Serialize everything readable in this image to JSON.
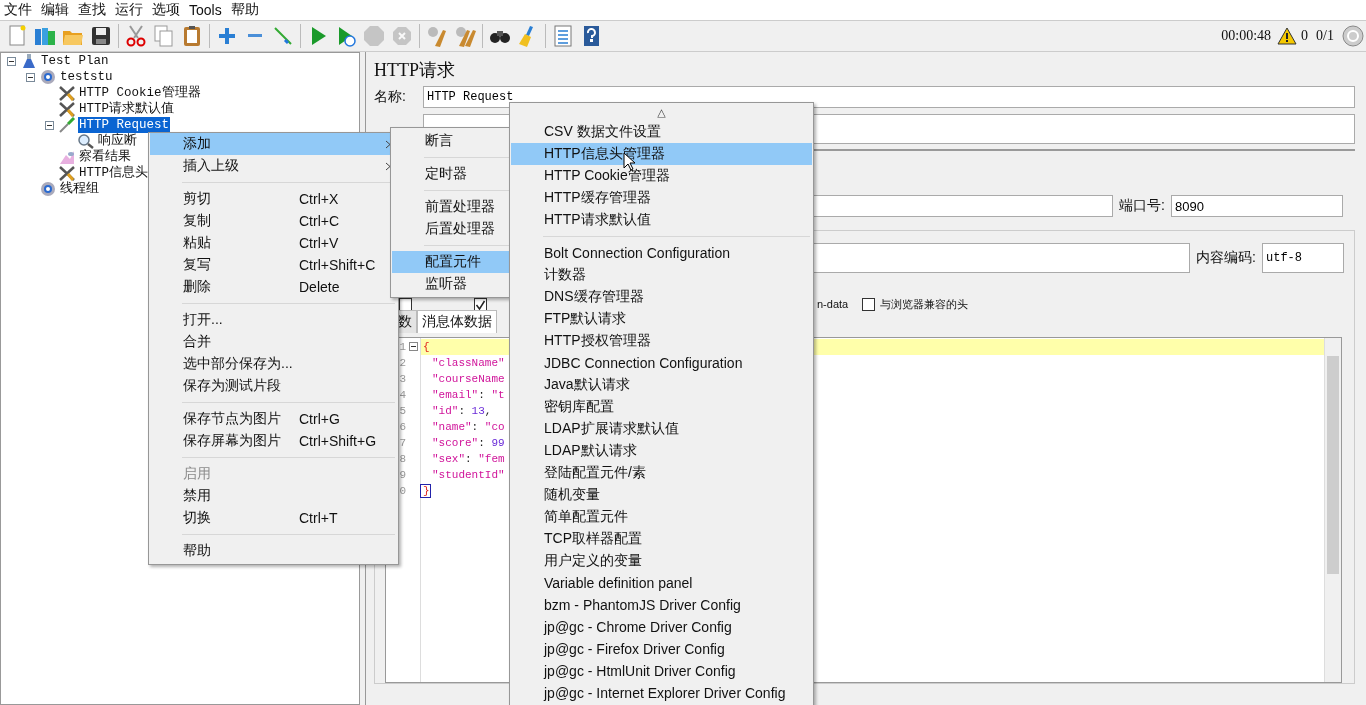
{
  "menubar": [
    "文件",
    "编辑",
    "查找",
    "运行",
    "选项",
    "Tools",
    "帮助"
  ],
  "toolbar": [
    {
      "kind": "new",
      "disabled": false
    },
    {
      "kind": "templates",
      "disabled": false
    },
    {
      "kind": "open",
      "disabled": false
    },
    {
      "kind": "save",
      "disabled": false
    },
    {
      "kind": "separator"
    },
    {
      "kind": "cut",
      "disabled": false
    },
    {
      "kind": "copy",
      "disabled": false
    },
    {
      "kind": "paste",
      "disabled": false
    },
    {
      "kind": "separator"
    },
    {
      "kind": "expand",
      "disabled": false
    },
    {
      "kind": "collapse",
      "disabled": false
    },
    {
      "kind": "toggle",
      "disabled": false
    },
    {
      "kind": "separator"
    },
    {
      "kind": "start",
      "disabled": false
    },
    {
      "kind": "start-no-pause",
      "disabled": false
    },
    {
      "kind": "stop",
      "disabled": true
    },
    {
      "kind": "shutdown",
      "disabled": true
    },
    {
      "kind": "separator"
    },
    {
      "kind": "clear",
      "disabled": false
    },
    {
      "kind": "clear-all",
      "disabled": false
    },
    {
      "kind": "separator"
    },
    {
      "kind": "search",
      "disabled": false
    },
    {
      "kind": "reset",
      "disabled": false
    },
    {
      "kind": "separator"
    },
    {
      "kind": "function-helper",
      "disabled": false
    },
    {
      "kind": "help",
      "disabled": false
    }
  ],
  "status": {
    "elapsed": "00:00:48",
    "warnings": "0",
    "threads": "0/1"
  },
  "tree": [
    {
      "label": "Test Plan",
      "kind": "plan",
      "selected": false,
      "expanded": true,
      "children": [
        {
          "label": "teststu",
          "kind": "group",
          "selected": false,
          "expanded": true,
          "children": [
            {
              "label": "HTTP Cookie管理器",
              "kind": "config",
              "selected": false
            },
            {
              "label": "HTTP请求默认值",
              "kind": "config",
              "selected": false
            },
            {
              "label": "HTTP Request",
              "kind": "sampler",
              "selected": true,
              "expanded": true,
              "children": [
                {
                  "label": "响应断",
                  "kind": "assertion",
                  "selected": false
                }
              ]
            },
            {
              "label": "察看结果",
              "kind": "listener",
              "selected": false
            },
            {
              "label": "HTTP信息头",
              "kind": "config",
              "selected": false
            }
          ]
        },
        {
          "label": "线程组",
          "kind": "group",
          "selected": false
        }
      ]
    }
  ],
  "panel": {
    "title": "HTTP请求",
    "name_label": "名称:",
    "name_value": "HTTP Request",
    "port_label": "端口号:",
    "port_value": "8090",
    "encoding_label": "内容编码:",
    "encoding_value": "utf-8",
    "checkboxes": [
      {
        "checked": false
      },
      {
        "checked": true
      },
      {
        "label": "n-data"
      },
      {
        "label": "与浏览器兼容的头",
        "checked": false
      }
    ],
    "tabs": [
      {
        "label": "数",
        "selected": false
      },
      {
        "label": "消息体数据",
        "selected": true
      }
    ],
    "editor": {
      "line_numbers": [
        "1",
        "2",
        "3",
        "4",
        "5",
        "6",
        "7",
        "8",
        "9",
        "0"
      ],
      "lines": [
        [
          {
            "kind": "brace",
            "text": "{"
          }
        ],
        [
          {
            "kind": "string",
            "text": "\"className\""
          }
        ],
        [
          {
            "kind": "string",
            "text": "\"courseName"
          }
        ],
        [
          {
            "kind": "string",
            "text": "\"email\""
          },
          {
            "kind": "plain",
            "text": ": "
          },
          {
            "kind": "string",
            "text": "\"t"
          }
        ],
        [
          {
            "kind": "string",
            "text": "\"id\""
          },
          {
            "kind": "plain",
            "text": ": "
          },
          {
            "kind": "number",
            "text": "13"
          },
          {
            "kind": "plain",
            "text": ","
          }
        ],
        [
          {
            "kind": "string",
            "text": "\"name\""
          },
          {
            "kind": "plain",
            "text": ": "
          },
          {
            "kind": "string",
            "text": "\"co"
          }
        ],
        [
          {
            "kind": "string",
            "text": "\"score\""
          },
          {
            "kind": "plain",
            "text": ": "
          },
          {
            "kind": "number",
            "text": "99"
          }
        ],
        [
          {
            "kind": "string",
            "text": "\"sex\""
          },
          {
            "kind": "plain",
            "text": ": "
          },
          {
            "kind": "string",
            "text": "\"fem"
          }
        ],
        [
          {
            "kind": "string",
            "text": "\"studentId\""
          }
        ],
        [
          {
            "kind": "brace",
            "text": "}"
          }
        ]
      ]
    }
  },
  "context_menu": [
    {
      "label": "添加",
      "kind": "submenu",
      "selected": true,
      "disabled": false
    },
    {
      "label": "插入上级",
      "kind": "submenu",
      "selected": false,
      "disabled": false
    },
    {
      "kind": "separator"
    },
    {
      "label": "剪切",
      "shortcut": "Ctrl+X",
      "kind": "item",
      "selected": false,
      "disabled": false
    },
    {
      "label": "复制",
      "shortcut": "Ctrl+C",
      "kind": "item",
      "selected": false,
      "disabled": false
    },
    {
      "label": "粘贴",
      "shortcut": "Ctrl+V",
      "kind": "item",
      "selected": false,
      "disabled": false
    },
    {
      "label": "复写",
      "shortcut": "Ctrl+Shift+C",
      "kind": "item",
      "selected": false,
      "disabled": false
    },
    {
      "label": "删除",
      "shortcut": "Delete",
      "kind": "item",
      "selected": false,
      "disabled": false
    },
    {
      "kind": "separator"
    },
    {
      "label": "打开...",
      "kind": "item",
      "selected": false,
      "disabled": false
    },
    {
      "label": "合并",
      "kind": "item",
      "selected": false,
      "disabled": false
    },
    {
      "label": "选中部分保存为...",
      "kind": "item",
      "selected": false,
      "disabled": false
    },
    {
      "label": "保存为测试片段",
      "kind": "item",
      "selected": false,
      "disabled": false
    },
    {
      "kind": "separator"
    },
    {
      "label": "保存节点为图片",
      "shortcut": "Ctrl+G",
      "kind": "item",
      "selected": false,
      "disabled": false
    },
    {
      "label": "保存屏幕为图片",
      "shortcut": "Ctrl+Shift+G",
      "kind": "item",
      "selected": false,
      "disabled": false
    },
    {
      "kind": "separator"
    },
    {
      "label": "启用",
      "kind": "item",
      "selected": false,
      "disabled": true
    },
    {
      "label": "禁用",
      "kind": "item",
      "selected": false,
      "disabled": false
    },
    {
      "label": "切换",
      "shortcut": "Ctrl+T",
      "kind": "item",
      "selected": false,
      "disabled": false
    },
    {
      "kind": "separator"
    },
    {
      "label": "帮助",
      "kind": "item",
      "selected": false,
      "disabled": false
    }
  ],
  "add_submenu": [
    {
      "label": "断言",
      "kind": "submenu",
      "selected": false
    },
    {
      "kind": "separator"
    },
    {
      "label": "定时器",
      "kind": "submenu",
      "selected": false
    },
    {
      "kind": "separator"
    },
    {
      "label": "前置处理器",
      "kind": "submenu",
      "selected": false
    },
    {
      "label": "后置处理器",
      "kind": "submenu",
      "selected": false
    },
    {
      "kind": "separator"
    },
    {
      "label": "配置元件",
      "kind": "submenu",
      "selected": true
    },
    {
      "label": "监听器",
      "kind": "submenu",
      "selected": false
    }
  ],
  "config_submenu": {
    "scroll_up": "△",
    "items": [
      {
        "label": "CSV 数据文件设置",
        "kind": "item",
        "selected": false
      },
      {
        "label": "HTTP信息头管理器",
        "kind": "item",
        "selected": true
      },
      {
        "label": "HTTP Cookie管理器",
        "kind": "item",
        "selected": false
      },
      {
        "label": "HTTP缓存管理器",
        "kind": "item",
        "selected": false
      },
      {
        "label": "HTTP请求默认值",
        "kind": "item",
        "selected": false
      },
      {
        "kind": "separator"
      },
      {
        "label": "Bolt Connection Configuration",
        "kind": "item",
        "selected": false
      },
      {
        "label": "计数器",
        "kind": "item",
        "selected": false
      },
      {
        "label": "DNS缓存管理器",
        "kind": "item",
        "selected": false
      },
      {
        "label": "FTP默认请求",
        "kind": "item",
        "selected": false
      },
      {
        "label": "HTTP授权管理器",
        "kind": "item",
        "selected": false
      },
      {
        "label": "JDBC Connection Configuration",
        "kind": "item",
        "selected": false
      },
      {
        "label": "Java默认请求",
        "kind": "item",
        "selected": false
      },
      {
        "label": "密钥库配置",
        "kind": "item",
        "selected": false
      },
      {
        "label": "LDAP扩展请求默认值",
        "kind": "item",
        "selected": false
      },
      {
        "label": "LDAP默认请求",
        "kind": "item",
        "selected": false
      },
      {
        "label": "登陆配置元件/素",
        "kind": "item",
        "selected": false
      },
      {
        "label": "随机变量",
        "kind": "item",
        "selected": false
      },
      {
        "label": "简单配置元件",
        "kind": "item",
        "selected": false
      },
      {
        "label": "TCP取样器配置",
        "kind": "item",
        "selected": false
      },
      {
        "label": "用户定义的变量",
        "kind": "item",
        "selected": false
      },
      {
        "label": "Variable definition panel",
        "kind": "item",
        "selected": false
      },
      {
        "label": "bzm - PhantomJS Driver Config",
        "kind": "item",
        "selected": false
      },
      {
        "label": "jp@gc - Chrome Driver Config",
        "kind": "item",
        "selected": false
      },
      {
        "label": "jp@gc - Firefox Driver Config",
        "kind": "item",
        "selected": false
      },
      {
        "label": "jp@gc - HtmlUnit Driver Config",
        "kind": "item",
        "selected": false
      },
      {
        "label": "jp@gc - Internet Explorer Driver Config",
        "kind": "item",
        "selected": false
      }
    ]
  }
}
